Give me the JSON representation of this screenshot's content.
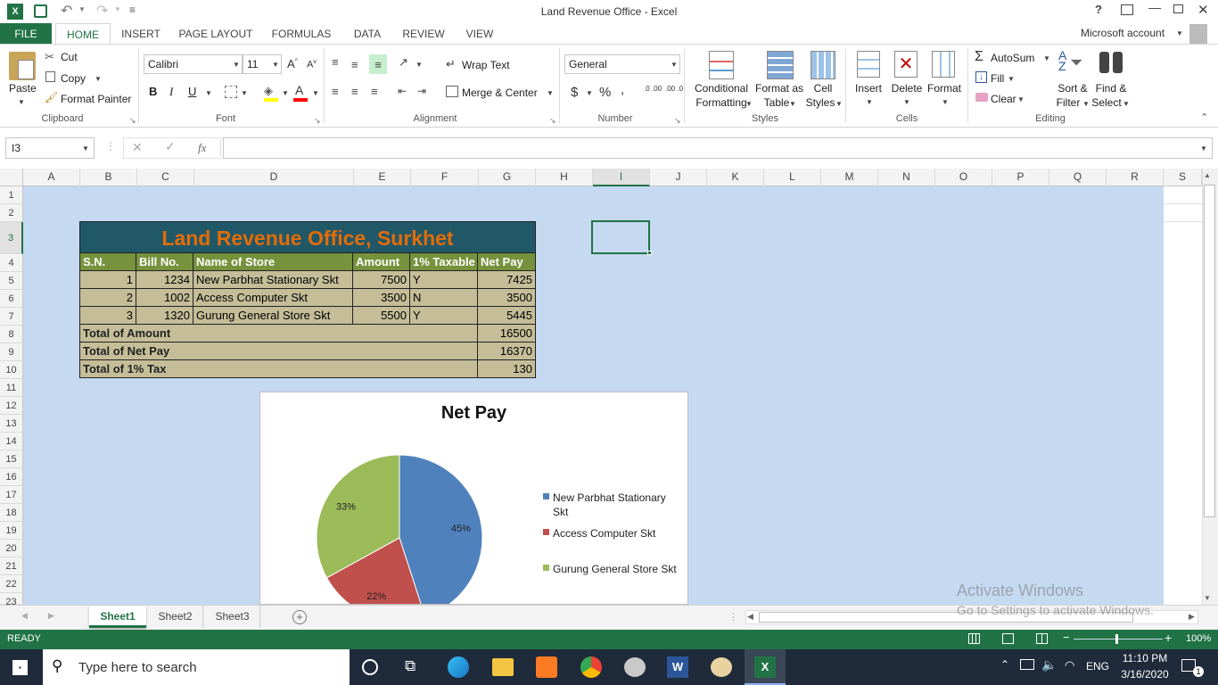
{
  "window": {
    "title": "Land Revenue Office - Excel",
    "account": "Microsoft account"
  },
  "ribbon_tabs": [
    "FILE",
    "HOME",
    "INSERT",
    "PAGE LAYOUT",
    "FORMULAS",
    "DATA",
    "REVIEW",
    "VIEW"
  ],
  "clipboard": {
    "paste": "Paste",
    "cut": "Cut",
    "copy": "Copy",
    "format_painter": "Format Painter",
    "label": "Clipboard"
  },
  "font": {
    "name": "Calibri",
    "size": "11",
    "bold": "B",
    "italic": "I",
    "underline": "U",
    "label": "Font"
  },
  "alignment": {
    "wrap_text": "Wrap Text",
    "merge_center": "Merge & Center",
    "label": "Alignment"
  },
  "number": {
    "format": "General",
    "currency": "$",
    "percent": "%",
    "comma": ",",
    "inc_decimal": ".0 .00",
    "dec_decimal": ".00 .0",
    "label": "Number"
  },
  "styles": {
    "conditional": "Conditional Formatting",
    "format_table": "Format as Table",
    "cell_styles": "Cell Styles",
    "label": "Styles",
    "cond_l1": "Conditional",
    "cond_l2": "Formatting",
    "table_l1": "Format as",
    "table_l2": "Table",
    "cell_l1": "Cell",
    "cell_l2": "Styles"
  },
  "cells": {
    "insert": "Insert",
    "delete": "Delete",
    "format": "Format",
    "label": "Cells"
  },
  "editing": {
    "autosum": "AutoSum",
    "fill": "Fill",
    "clear": "Clear",
    "sort_l1": "Sort &",
    "sort_l2": "Filter",
    "find_l1": "Find &",
    "find_l2": "Select",
    "label": "Editing"
  },
  "formula_bar": {
    "name_box": "I3",
    "fx": "fx",
    "value": ""
  },
  "columns": [
    "A",
    "B",
    "C",
    "D",
    "E",
    "F",
    "G",
    "H",
    "I",
    "J",
    "K",
    "L",
    "M",
    "N",
    "O",
    "P",
    "Q",
    "R",
    "S"
  ],
  "rows": [
    "1",
    "2",
    "3",
    "4",
    "5",
    "6",
    "7",
    "8",
    "9",
    "10",
    "11",
    "12",
    "13",
    "14",
    "15",
    "16",
    "17",
    "18",
    "19",
    "20",
    "21",
    "22",
    "23"
  ],
  "table": {
    "title": "Land Revenue Office, Surkhet",
    "headers": [
      "S.N.",
      "Bill No.",
      "Name of Store",
      "Amount",
      "1% Taxable",
      "Net Pay"
    ],
    "rows": [
      [
        "1",
        "1234",
        "New Parbhat Stationary Skt",
        "7500",
        "Y",
        "7425"
      ],
      [
        "2",
        "1002",
        "Access Computer Skt",
        "3500",
        "N",
        "3500"
      ],
      [
        "3",
        "1320",
        "Gurung General Store Skt",
        "5500",
        "Y",
        "5445"
      ]
    ],
    "totals": [
      {
        "label": "Total of Amount",
        "value": "16500"
      },
      {
        "label": "Total of Net Pay",
        "value": "16370"
      },
      {
        "label": "Total of 1% Tax",
        "value": "130"
      }
    ]
  },
  "chart_data": {
    "type": "pie",
    "title": "Net Pay",
    "categories": [
      "New Parbhat Stationary Skt",
      "Access Computer Skt",
      "Gurung General Store Skt"
    ],
    "values": [
      45,
      22,
      33
    ],
    "labels": [
      "45%",
      "22%",
      "33%"
    ],
    "colors": [
      "#4f81bd",
      "#c0504d",
      "#9bbb59"
    ],
    "legend": "right"
  },
  "sheets": [
    "Sheet1",
    "Sheet2",
    "Sheet3"
  ],
  "status": {
    "mode": "READY",
    "zoom": "100%"
  },
  "watermark": {
    "line1": "Activate Windows",
    "line2": "Go to Settings to activate Windows."
  },
  "taskbar": {
    "search_placeholder": "Type here to search",
    "lang": "ENG",
    "time": "11:10 PM",
    "date": "3/16/2020",
    "notif_count": "1"
  }
}
